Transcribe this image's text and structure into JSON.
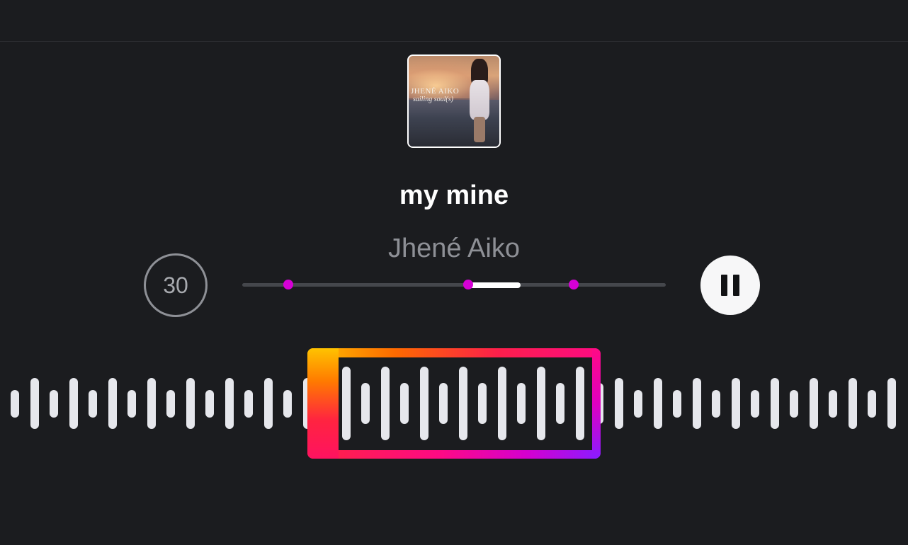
{
  "track": {
    "title": "my mine",
    "artist": "Jhené Aiko"
  },
  "album_art": {
    "icon": "album-cover",
    "cover_title": "JHENÉ AIKO",
    "cover_subtitle": "sailing soul(s)"
  },
  "controls": {
    "skip_label": "30",
    "pause_icon": "pause-icon"
  },
  "progress": {
    "played_fraction_start": 0.535,
    "played_fraction_end": 0.658,
    "markers": [
      0.109,
      0.533,
      0.783
    ]
  },
  "colors": {
    "background": "#1b1c1f",
    "marker": "#d600d6",
    "waveform_bar": "#e6e7ec",
    "trim_gradient": [
      "#ffc300",
      "#ff6a00",
      "#ff1f4b",
      "#ff0a84",
      "#d400d0",
      "#8a1cff"
    ]
  },
  "waveform": {
    "bar_levels": [
      0.3,
      0.55,
      0.3,
      0.55,
      0.3,
      0.55,
      0.3,
      0.55,
      0.3,
      0.55,
      0.3,
      0.55,
      0.3,
      0.55,
      0.3,
      0.55,
      0.3,
      0.8,
      0.45,
      0.8,
      0.45,
      0.8,
      0.45,
      0.8,
      0.45,
      0.8,
      0.45,
      0.8,
      0.45,
      0.8,
      0.45,
      0.55,
      0.3,
      0.55,
      0.3,
      0.55,
      0.3,
      0.55,
      0.3,
      0.55,
      0.3,
      0.55,
      0.3,
      0.55,
      0.3,
      0.55
    ]
  }
}
